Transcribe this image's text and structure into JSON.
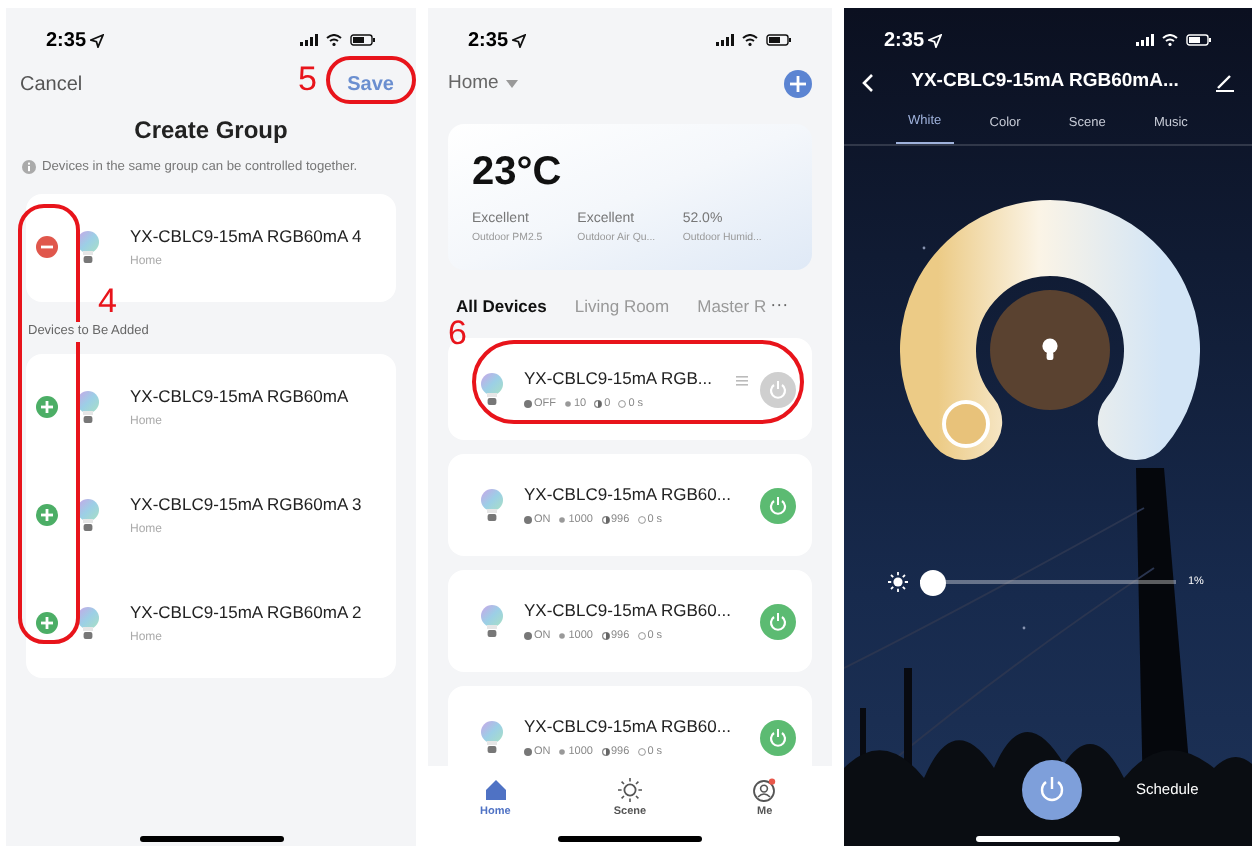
{
  "group_screen": {
    "time": "2:35",
    "cancel": "Cancel",
    "save": "Save",
    "title": "Create Group",
    "info": "Devices in the same group can be controlled together.",
    "members": [
      {
        "name": "YX-CBLC9-15mA RGB60mA 4",
        "room": "Home",
        "kind": "remove"
      }
    ],
    "section_label": "Devices to Be Added",
    "candidates": [
      {
        "name": "YX-CBLC9-15mA RGB60mA",
        "room": "Home",
        "kind": "add"
      },
      {
        "name": "YX-CBLC9-15mA RGB60mA 3",
        "room": "Home",
        "kind": "add"
      },
      {
        "name": "YX-CBLC9-15mA RGB60mA 2",
        "room": "Home",
        "kind": "add"
      }
    ]
  },
  "home_screen": {
    "time": "2:35",
    "home": "Home",
    "temperature": "23°C",
    "metrics": [
      {
        "value": "Excellent",
        "label": "Outdoor PM2.5"
      },
      {
        "value": "Excellent",
        "label": "Outdoor Air Qu..."
      },
      {
        "value": "52.0%",
        "label": "Outdoor Humid..."
      }
    ],
    "rooms": [
      {
        "label": "All Devices",
        "selected": true
      },
      {
        "label": "Living Room",
        "selected": false
      },
      {
        "label": "Master R",
        "selected": false
      }
    ],
    "more": "···",
    "devices": [
      {
        "name": "YX-CBLC9-15mA RGB...",
        "status": "OFF",
        "brightness": "10",
        "temp": "0",
        "timer": "0 s",
        "on": false,
        "handle": true
      },
      {
        "name": "YX-CBLC9-15mA RGB60...",
        "status": "ON",
        "brightness": "1000",
        "temp": "996",
        "timer": "0 s",
        "on": true,
        "handle": false
      },
      {
        "name": "YX-CBLC9-15mA RGB60...",
        "status": "ON",
        "brightness": "1000",
        "temp": "996",
        "timer": "0 s",
        "on": true,
        "handle": false
      },
      {
        "name": "YX-CBLC9-15mA RGB60...",
        "status": "ON",
        "brightness": "1000",
        "temp": "996",
        "timer": "0 s",
        "on": true,
        "handle": false
      }
    ],
    "nav": [
      {
        "label": "Home",
        "selected": true,
        "kind": "home"
      },
      {
        "label": "Scene",
        "selected": false,
        "kind": "scene"
      },
      {
        "label": "Me",
        "selected": false,
        "kind": "me"
      }
    ]
  },
  "light_screen": {
    "time": "2:35",
    "title": "YX-CBLC9-15mA RGB60mA...",
    "tabs": [
      {
        "label": "White",
        "selected": true
      },
      {
        "label": "Color",
        "selected": false
      },
      {
        "label": "Scene",
        "selected": false
      },
      {
        "label": "Music",
        "selected": false
      }
    ],
    "brightness": {
      "level": 0.01,
      "reading": "1%"
    },
    "schedule": "Schedule"
  },
  "annotations": [
    {
      "label": "5"
    },
    {
      "label": "4"
    },
    {
      "label": "6"
    }
  ]
}
